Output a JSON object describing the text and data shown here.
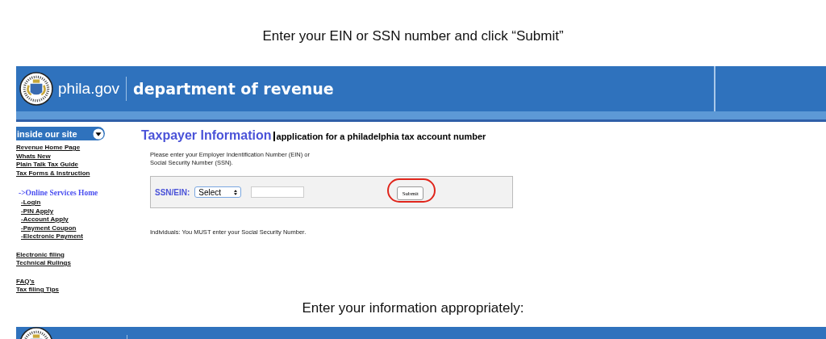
{
  "top_caption": "Enter your EIN or SSN number and click “Submit”",
  "header": {
    "site": "phila.gov",
    "department": "department of revenue"
  },
  "sidebar": {
    "heading": "inside our site",
    "groups": [
      [
        {
          "label": "Revenue Home Page",
          "selected": false
        },
        {
          "label": "Whats New",
          "selected": false
        },
        {
          "label": "Plain Talk Tax Guide",
          "selected": false
        },
        {
          "label": "Tax Forms & Instruction",
          "selected": false
        }
      ],
      [
        {
          "label": "->Online Services Home",
          "selected": true,
          "children": [
            {
              "label": "-Login",
              "selected": false
            },
            {
              "label": "-PIN Apply",
              "selected": false
            },
            {
              "label": "-Account Apply",
              "selected": false
            },
            {
              "label": "-Payment Coupon",
              "selected": false
            },
            {
              "label": "-Electronic Payment",
              "selected": false
            }
          ]
        }
      ],
      [
        {
          "label": "Electronic filing",
          "selected": false
        },
        {
          "label": "Technical Rulings",
          "selected": false
        }
      ],
      [
        {
          "label": "FAQ's",
          "selected": false
        },
        {
          "label": "Tax filing Tips",
          "selected": false
        }
      ]
    ]
  },
  "main": {
    "title": "Taxpayer Information",
    "subtitle": "application for a philadelphia tax account number",
    "instructions": "Please enter your Employer Indentification Number (EIN) or\nSocial Security Number (SSN).",
    "form": {
      "label": "SSN/EIN:",
      "select": "Select",
      "button": "Submit",
      "highlighted": true
    },
    "note": "Individuals: You MUST enter your Social Security Number."
  },
  "bottom_caption": "Enter your information appropriately:"
}
